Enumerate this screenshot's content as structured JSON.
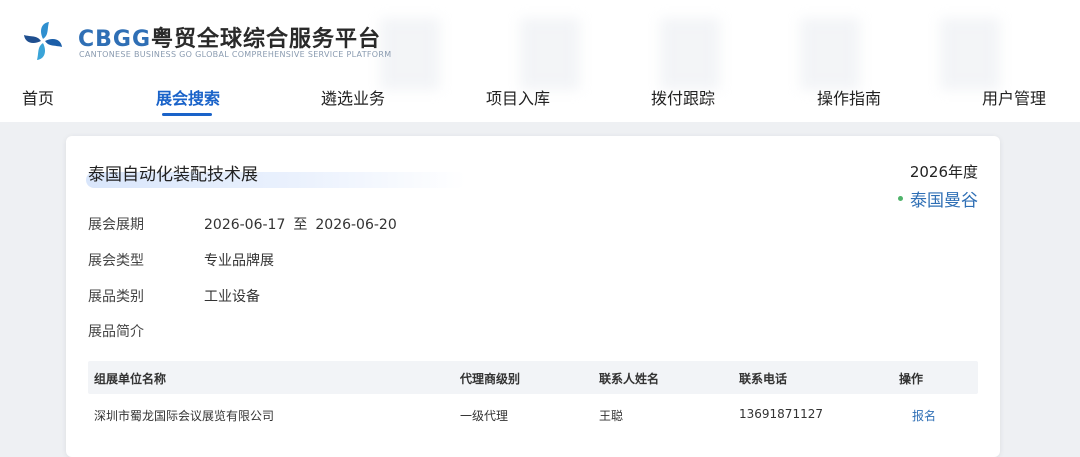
{
  "header": {
    "logo_icon": "pinwheel-logo-icon",
    "brand_en": "CBGG",
    "brand_cn": "粤贸全球综合服务平台",
    "brand_sub": "CANTONESE BUSINESS GO GLOBAL COMPREHENSIVE SERVICE PLATFORM",
    "brand_color": "#2f6fb5"
  },
  "nav": {
    "items": [
      {
        "label": "首页"
      },
      {
        "label": "展会搜索",
        "active": true
      },
      {
        "label": "遴选业务"
      },
      {
        "label": "项目入库"
      },
      {
        "label": "拨付跟踪"
      },
      {
        "label": "操作指南"
      },
      {
        "label": "用户管理"
      }
    ],
    "accent_color": "#1a63c9"
  },
  "exhibition": {
    "title": "泰国自动化装配技术展",
    "year": "2026年度",
    "city": "泰国曼谷",
    "fields": [
      {
        "label": "展会展期",
        "start": "2026-06-17",
        "sep": "至",
        "end": "2026-06-20"
      },
      {
        "label": "展会类型",
        "value": "专业品牌展"
      },
      {
        "label": "展品类别",
        "value": "工业设备"
      },
      {
        "label": "展品简介",
        "value": ""
      }
    ]
  },
  "table": {
    "columns": [
      "组展单位名称",
      "代理商级别",
      "联系人姓名",
      "联系电话",
      "操作"
    ],
    "rows": [
      {
        "organizer": "深圳市蜀龙国际会议展览有限公司",
        "agent_level": "一级代理",
        "contact": "王聪",
        "phone": "13691871127",
        "action": "报名"
      }
    ]
  }
}
